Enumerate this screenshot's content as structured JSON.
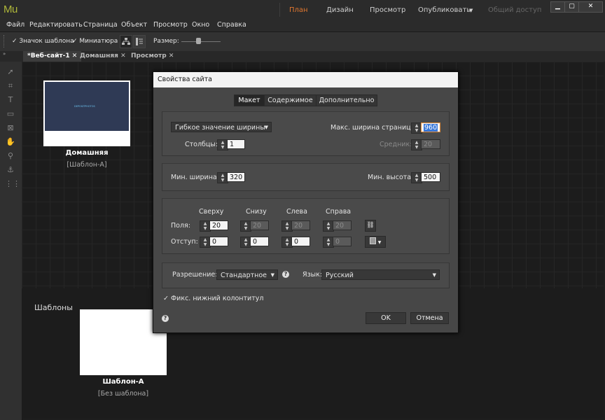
{
  "app": {
    "logo": "Mu",
    "modes": [
      "План",
      "Дизайн",
      "Просмотр",
      "Опубликовать",
      "Общий доступ"
    ],
    "active_mode": "План",
    "publish_arrow": "▼",
    "window_buttons": {
      "minimize": "▁",
      "maximize": "▢",
      "close": "✕"
    }
  },
  "menu": [
    "Файл",
    "Редактировать",
    "Страница",
    "Объект",
    "Просмотр",
    "Окно",
    "Справка"
  ],
  "toolbar": {
    "template_icon_label": "Значок шаблона",
    "thumbnail_label": "Миниатюра",
    "size_label": "Размер:"
  },
  "tabs": [
    {
      "label": "*Веб-сайт-1",
      "close": "✕"
    },
    {
      "label": "Домашняя",
      "close": "✕"
    },
    {
      "label": "Просмотр",
      "close": "✕"
    }
  ],
  "canvas": {
    "home_page": {
      "name": "Домашняя",
      "template": "[Шаблон-А]",
      "thumb_text": "DEPOSITPHOTOS"
    },
    "templates_heading": "Шаблоны",
    "template_a": {
      "name": "Шаблон-А",
      "template": "[Без шаблона]"
    }
  },
  "dialog": {
    "title": "Свойства сайта",
    "tabs": [
      "Макет",
      "Содержимое",
      "Дополнительно"
    ],
    "active_tab": "Макет",
    "width_mode": "Гибкое значение ширины",
    "max_width_label": "Макс. ширина страницы:",
    "max_width": "960",
    "columns_label": "Столбцы:",
    "columns": "1",
    "gutter_label": "Средник:",
    "gutter": "20",
    "min_width_label": "Мин. ширина:",
    "min_width": "320",
    "min_height_label": "Мин. высота:",
    "min_height": "500",
    "margins": {
      "headers": [
        "Сверху",
        "Снизу",
        "Слева",
        "Справа"
      ],
      "fields_label": "Поля:",
      "fields": [
        "20",
        "20",
        "20",
        "20"
      ],
      "padding_label": "Отступ:",
      "padding": [
        "0",
        "0",
        "0",
        "0"
      ]
    },
    "resolution_label": "Разрешение:",
    "resolution": "Стандартное",
    "language_label": "Язык:",
    "language": "Русский",
    "sticky_footer_label": "Фикс. нижний колонтитул",
    "help_icon": "?",
    "ok_label": "OK",
    "cancel_label": "Отмена"
  }
}
